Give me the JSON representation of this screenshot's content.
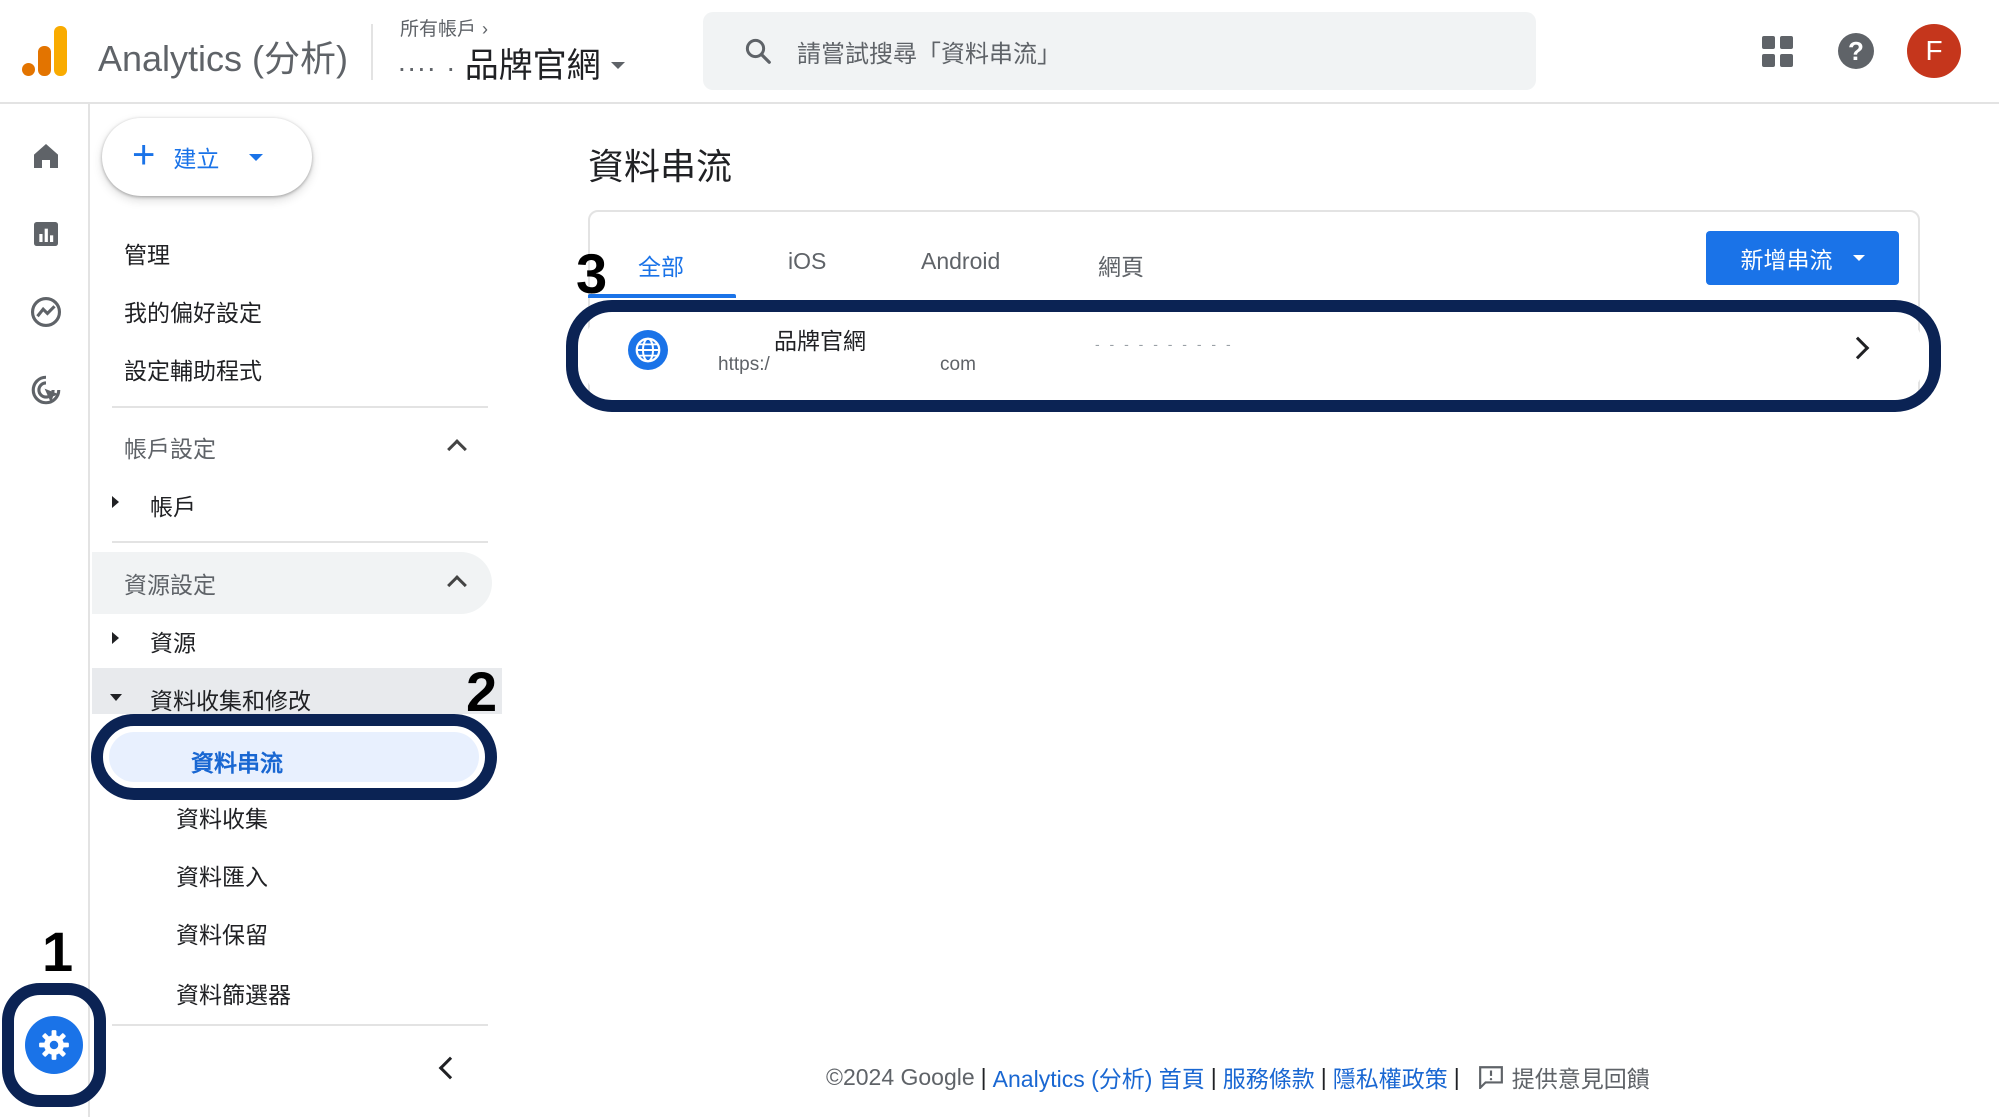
{
  "header": {
    "app_title": "Analytics (分析)",
    "breadcrumb": "所有帳戶",
    "property_prefix": "....  .",
    "property_name": "品牌官網",
    "search_placeholder": "請嘗試搜尋「資料串流」",
    "avatar_letter": "F",
    "help_glyph": "?"
  },
  "rail": {
    "items": [
      "home-icon",
      "reports-icon",
      "explore-icon",
      "advertising-icon"
    ],
    "admin_icon": "gear-icon"
  },
  "sidebar": {
    "create_label": "建立",
    "top_items": [
      "管理",
      "我的偏好設定",
      "設定輔助程式"
    ],
    "account_section": {
      "heading": "帳戶設定",
      "items": [
        "帳戶"
      ]
    },
    "property_section": {
      "heading": "資源設定",
      "items": [
        "資源",
        "資料收集和修改"
      ],
      "sub_items": [
        "資料串流",
        "資料收集",
        "資料匯入",
        "資料保留",
        "資料篩選器"
      ],
      "active": "資料串流"
    }
  },
  "main": {
    "title": "資料串流",
    "tabs": [
      "全部",
      "iOS",
      "Android",
      "網頁"
    ],
    "active_tab": "全部",
    "add_stream_label": "新增串流",
    "stream": {
      "name": "品牌官網",
      "url_part1": "https:/",
      "url_part2": "com",
      "id_blurred": "- - -  - - - - - - -"
    }
  },
  "annotations": {
    "step1": "1",
    "step2": "2",
    "step3": "3"
  },
  "footer": {
    "copyright": "©2024 Google",
    "links": [
      "Analytics (分析) 首頁",
      "服務條款",
      "隱私權政策"
    ],
    "feedback": "提供意見回饋"
  },
  "colors": {
    "accent": "#1a73e8",
    "highlight_outline": "#0b2354",
    "avatar": "#c5361c",
    "logo_orange": "#e37400",
    "logo_yellow": "#f9ab00"
  }
}
